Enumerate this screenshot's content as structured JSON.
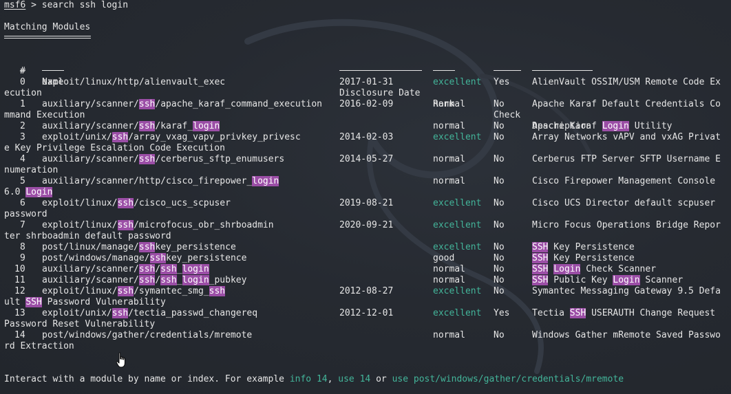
{
  "prompt": {
    "label": "msf6",
    "sep": " > ",
    "command": "search ssh login"
  },
  "section_title": "Matching Modules",
  "columns": {
    "num": "#",
    "name": "Name",
    "date": "Disclosure Date",
    "rank": "Rank",
    "check": "Check",
    "desc": "Description"
  },
  "rows": [
    {
      "num": "0",
      "name": "exploit/linux/http/alienvault_exec",
      "name_parts": [
        [
          "exploit/linux/http/alienvault_exec",
          false
        ]
      ],
      "date": "2017-01-31",
      "rank": "excellent",
      "check": "Yes",
      "desc_parts": [
        [
          "AlienVault OSSIM/USM Remote Code Ex",
          false
        ]
      ],
      "wrap_parts": [
        [
          "ecution",
          false
        ]
      ]
    },
    {
      "num": "1",
      "name": "auxiliary/scanner/ssh/apache_karaf_command_execution",
      "name_parts": [
        [
          "auxiliary/scanner/",
          false
        ],
        [
          "ssh",
          true
        ],
        [
          "/apache_karaf_command_execution",
          false
        ]
      ],
      "date": "2016-02-09",
      "rank": "normal",
      "check": "No",
      "desc_parts": [
        [
          "Apache Karaf Default Credentials Co",
          false
        ]
      ],
      "wrap_parts": [
        [
          "mmand Execution",
          false
        ]
      ]
    },
    {
      "num": "2",
      "name": "auxiliary/scanner/ssh/karaf_login",
      "name_parts": [
        [
          "auxiliary/scanner/",
          false
        ],
        [
          "ssh",
          true
        ],
        [
          "/karaf_",
          false
        ],
        [
          "login",
          true
        ]
      ],
      "date": "",
      "rank": "normal",
      "check": "No",
      "desc_parts": [
        [
          "Apache Karaf ",
          false
        ],
        [
          "Login",
          true
        ],
        [
          " Utility",
          false
        ]
      ],
      "wrap_parts": []
    },
    {
      "num": "3",
      "name": "exploit/unix/ssh/array_vxag_vapv_privkey_privesc",
      "name_parts": [
        [
          "exploit/unix/",
          false
        ],
        [
          "ssh",
          true
        ],
        [
          "/array_vxag_vapv_privkey_privesc",
          false
        ]
      ],
      "date": "2014-02-03",
      "rank": "excellent",
      "check": "No",
      "desc_parts": [
        [
          "Array Networks vAPV and vxAG Privat",
          false
        ]
      ],
      "wrap_parts": [
        [
          "e Key Privilege Escalation Code Execution",
          false
        ]
      ]
    },
    {
      "num": "4",
      "name": "auxiliary/scanner/ssh/cerberus_sftp_enumusers",
      "name_parts": [
        [
          "auxiliary/scanner/",
          false
        ],
        [
          "ssh",
          true
        ],
        [
          "/cerberus_sftp_enumusers",
          false
        ]
      ],
      "date": "2014-05-27",
      "rank": "normal",
      "check": "No",
      "desc_parts": [
        [
          "Cerberus FTP Server SFTP Username E",
          false
        ]
      ],
      "wrap_parts": [
        [
          "numeration",
          false
        ]
      ]
    },
    {
      "num": "5",
      "name": "auxiliary/scanner/http/cisco_firepower_login",
      "name_parts": [
        [
          "auxiliary/scanner/http/cisco_firepower_",
          false
        ],
        [
          "login",
          true
        ]
      ],
      "date": "",
      "rank": "normal",
      "check": "No",
      "desc_parts": [
        [
          "Cisco Firepower Management Console",
          false
        ]
      ],
      "wrap_parts": [
        [
          "6.0 ",
          false
        ],
        [
          "Login",
          true
        ]
      ]
    },
    {
      "num": "6",
      "name": "exploit/linux/ssh/cisco_ucs_scpuser",
      "name_parts": [
        [
          "exploit/linux/",
          false
        ],
        [
          "ssh",
          true
        ],
        [
          "/cisco_ucs_scpuser",
          false
        ]
      ],
      "date": "2019-08-21",
      "rank": "excellent",
      "check": "No",
      "desc_parts": [
        [
          "Cisco UCS Director default scpuser",
          false
        ]
      ],
      "wrap_parts": [
        [
          "password",
          false
        ]
      ]
    },
    {
      "num": "7",
      "name": "exploit/linux/ssh/microfocus_obr_shrboadmin",
      "name_parts": [
        [
          "exploit/linux/",
          false
        ],
        [
          "ssh",
          true
        ],
        [
          "/microfocus_obr_shrboadmin",
          false
        ]
      ],
      "date": "2020-09-21",
      "rank": "excellent",
      "check": "No",
      "desc_parts": [
        [
          "Micro Focus Operations Bridge Repor",
          false
        ]
      ],
      "wrap_parts": [
        [
          "ter shrboadmin default password",
          false
        ]
      ]
    },
    {
      "num": "8",
      "name": "post/linux/manage/sshkey_persistence",
      "name_parts": [
        [
          "post/linux/manage/",
          false
        ],
        [
          "ssh",
          true
        ],
        [
          "key_persistence",
          false
        ]
      ],
      "date": "",
      "rank": "excellent",
      "check": "No",
      "desc_parts": [
        [
          "SSH",
          true
        ],
        [
          " Key Persistence",
          false
        ]
      ],
      "wrap_parts": []
    },
    {
      "num": "9",
      "name": "post/windows/manage/sshkey_persistence",
      "name_parts": [
        [
          "post/windows/manage/",
          false
        ],
        [
          "ssh",
          true
        ],
        [
          "key_persistence",
          false
        ]
      ],
      "date": "",
      "rank": "good",
      "check": "No",
      "desc_parts": [
        [
          "SSH",
          true
        ],
        [
          " Key Persistence",
          false
        ]
      ],
      "wrap_parts": []
    },
    {
      "num": "10",
      "name": "auxiliary/scanner/ssh/ssh_login",
      "name_parts": [
        [
          "auxiliary/scanner/",
          false
        ],
        [
          "ssh",
          true
        ],
        [
          "/",
          false
        ],
        [
          "ssh",
          true
        ],
        [
          "_",
          false
        ],
        [
          "login",
          true
        ]
      ],
      "date": "",
      "rank": "normal",
      "check": "No",
      "desc_parts": [
        [
          "SSH",
          true
        ],
        [
          " ",
          false
        ],
        [
          "Login",
          true
        ],
        [
          " Check Scanner",
          false
        ]
      ],
      "wrap_parts": []
    },
    {
      "num": "11",
      "name": "auxiliary/scanner/ssh/ssh_login_pubkey",
      "name_parts": [
        [
          "auxiliary/scanner/",
          false
        ],
        [
          "ssh",
          true
        ],
        [
          "/",
          false
        ],
        [
          "ssh",
          true
        ],
        [
          "_",
          false
        ],
        [
          "login",
          true
        ],
        [
          "_pubkey",
          false
        ]
      ],
      "date": "",
      "rank": "normal",
      "check": "No",
      "desc_parts": [
        [
          "SSH",
          true
        ],
        [
          " Public Key ",
          false
        ],
        [
          "Login",
          true
        ],
        [
          " Scanner",
          false
        ]
      ],
      "wrap_parts": []
    },
    {
      "num": "12",
      "name": "exploit/linux/ssh/symantec_smg_ssh",
      "name_parts": [
        [
          "exploit/linux/",
          false
        ],
        [
          "ssh",
          true
        ],
        [
          "/symantec_smg_",
          false
        ],
        [
          "ssh",
          true
        ]
      ],
      "date": "2012-08-27",
      "rank": "excellent",
      "check": "No",
      "desc_parts": [
        [
          "Symantec Messaging Gateway 9.5 Defa",
          false
        ]
      ],
      "wrap_parts": [
        [
          "ult ",
          false
        ],
        [
          "SSH",
          true
        ],
        [
          " Password Vulnerability",
          false
        ]
      ]
    },
    {
      "num": "13",
      "name": "exploit/unix/ssh/tectia_passwd_changereq",
      "name_parts": [
        [
          "exploit/unix/",
          false
        ],
        [
          "ssh",
          true
        ],
        [
          "/tectia_passwd_changereq",
          false
        ]
      ],
      "date": "2012-12-01",
      "rank": "excellent",
      "check": "Yes",
      "desc_parts": [
        [
          "Tectia ",
          false
        ],
        [
          "SSH",
          true
        ],
        [
          " USERAUTH Change Request",
          false
        ]
      ],
      "wrap_parts": [
        [
          "Password Reset Vulnerability",
          false
        ]
      ]
    },
    {
      "num": "14",
      "name": "post/windows/gather/credentials/mremote",
      "name_parts": [
        [
          "post/windows/gather/credentials/mremote",
          false
        ]
      ],
      "date": "",
      "rank": "normal",
      "check": "No",
      "desc_parts": [
        [
          "Windows Gather mRemote Saved Passwo",
          false
        ]
      ],
      "wrap_parts": [
        [
          "rd Extraction",
          false
        ]
      ]
    }
  ],
  "footer": {
    "intro": "Interact with a module by name or index. For example ",
    "ex1": "info 14",
    "sep1": ", ",
    "ex2": "use 14",
    "sep2": " or ",
    "ex3": "use post/windows/gather/credentials/mremote"
  },
  "colors": {
    "background": "#23272e",
    "text": "#e6e6e6",
    "highlight": "#9b4ea6",
    "accent_green": "#43b59a"
  },
  "icons": {
    "cursor": "hand-pointer-cursor-icon"
  }
}
